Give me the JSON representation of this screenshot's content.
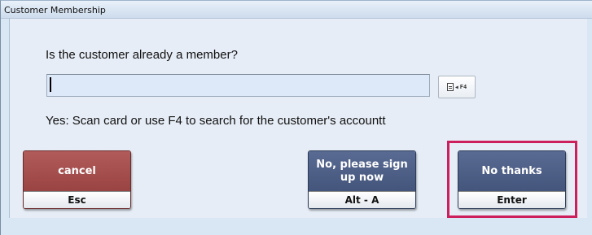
{
  "window": {
    "title": "Customer Membership"
  },
  "prompt": {
    "question": "Is the customer already a member?",
    "input_value": "",
    "hint": "Yes: Scan card or use F4 to search for the customer's accountt"
  },
  "search": {
    "key_label": "F4"
  },
  "buttons": {
    "cancel": {
      "label": "cancel",
      "shortcut": "Esc"
    },
    "signup": {
      "label": "No, please sign up now",
      "shortcut": "Alt - A"
    },
    "no_thanks": {
      "label": "No thanks",
      "shortcut": "Enter"
    }
  },
  "colors": {
    "cancel_button": "#9a4343",
    "action_button": "#44557c",
    "highlight_border": "#cc1f5c",
    "input_background": "#dde9f9"
  }
}
